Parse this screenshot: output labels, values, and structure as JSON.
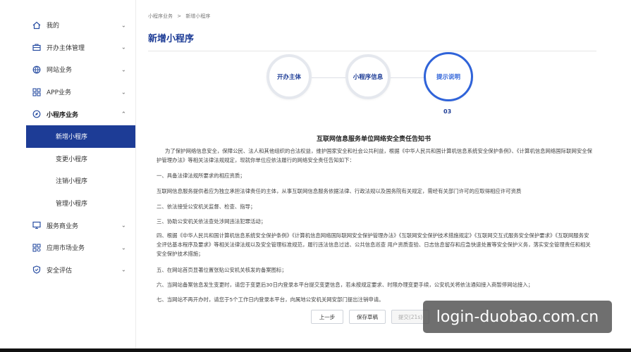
{
  "sidebar": {
    "items": [
      {
        "label": "我的",
        "icon": "home-icon",
        "chevron": "⌄"
      },
      {
        "label": "开办主体管理",
        "icon": "briefcase-icon",
        "chevron": "⌄"
      },
      {
        "label": "网站业务",
        "icon": "globe-icon",
        "chevron": "⌄"
      },
      {
        "label": "APP业务",
        "icon": "grid-icon",
        "chevron": "⌄"
      },
      {
        "label": "小程序业务",
        "icon": "compass-icon",
        "chevron": "⌃"
      },
      {
        "label": "新增小程序"
      },
      {
        "label": "变更小程序"
      },
      {
        "label": "注销小程序"
      },
      {
        "label": "管理小程序"
      },
      {
        "label": "服务商业务",
        "icon": "monitor-icon",
        "chevron": "⌄"
      },
      {
        "label": "应用市场业务",
        "icon": "apps-icon",
        "chevron": "⌄"
      },
      {
        "label": "安全评估",
        "icon": "shield-icon",
        "chevron": "⌄"
      }
    ]
  },
  "breadcrumb": {
    "parent": "小程序业务",
    "separator": ">",
    "current": "新增小程序"
  },
  "page_title": "新增小程序",
  "steps": [
    {
      "label": "开办主体"
    },
    {
      "label": "小程序信息"
    },
    {
      "label": "提示说明",
      "number": "03"
    }
  ],
  "doc": {
    "title": "互联网信息服务单位网络安全责任告知书",
    "paragraphs": [
      "为了保护网络信息安全，保障公民、法人和其他组织的合法权益，维护国家安全和社会公共利益，根据《中华人民共和国计算机信息系统安全保护条例》、《计算机信息网络国际联网安全保护管理办法》等相关法律法规规定，现就你单位应依法履行的网络安全责任告知如下：",
      "一、具备法律法规所要求的相应资质；",
      "互联网信息服务提供者应为独立承担法律责任的主体，从事互联网信息服务依据法律、行政法规以及国务院有关规定，需经有关部门许可的应取得相应许可资质",
      "二、依法接受公安机关监督、检查、指导；",
      "三、协助公安机关依法查处涉网违法犯罪活动；",
      "四、根据《中华人民共和国计算机信息系统安全保护条例》《计算机信息网络国际联网安全保护管理办法》《互联网安全保护技术措施规定》《互联网交互式服务安全保护要求》《互联网服务安全评估基本程序及要求》等相关法律法规以及安全管理标准规范，履行违法信息过滤、公共信息巡查 用户资质查验、日志信息留存和应急快速处置等安全保护义务，落实安全管理责任和相关安全保护技术措施；",
      "五、在网站首页显著位置张贴公安机关核发的备案图标；",
      "六、当网站备案信息发生变更时，请您于变更后30日内登录本平台提交变更信息，若未按规定要求、时限办理变更手续，公安机关将依法通知接入商暂停网站接入；",
      "七、当网站不再开办时，请您于5个工作日内登录本平台，向属地公安机关网安部门提出注销申请。"
    ]
  },
  "buttons": {
    "prev": "上一步",
    "save": "保存草稿",
    "submit": "提交(21s)"
  },
  "watermark": "login-duobao.com.cn",
  "colors": {
    "brand": "#1d3c96",
    "accent": "#2f63d9"
  }
}
